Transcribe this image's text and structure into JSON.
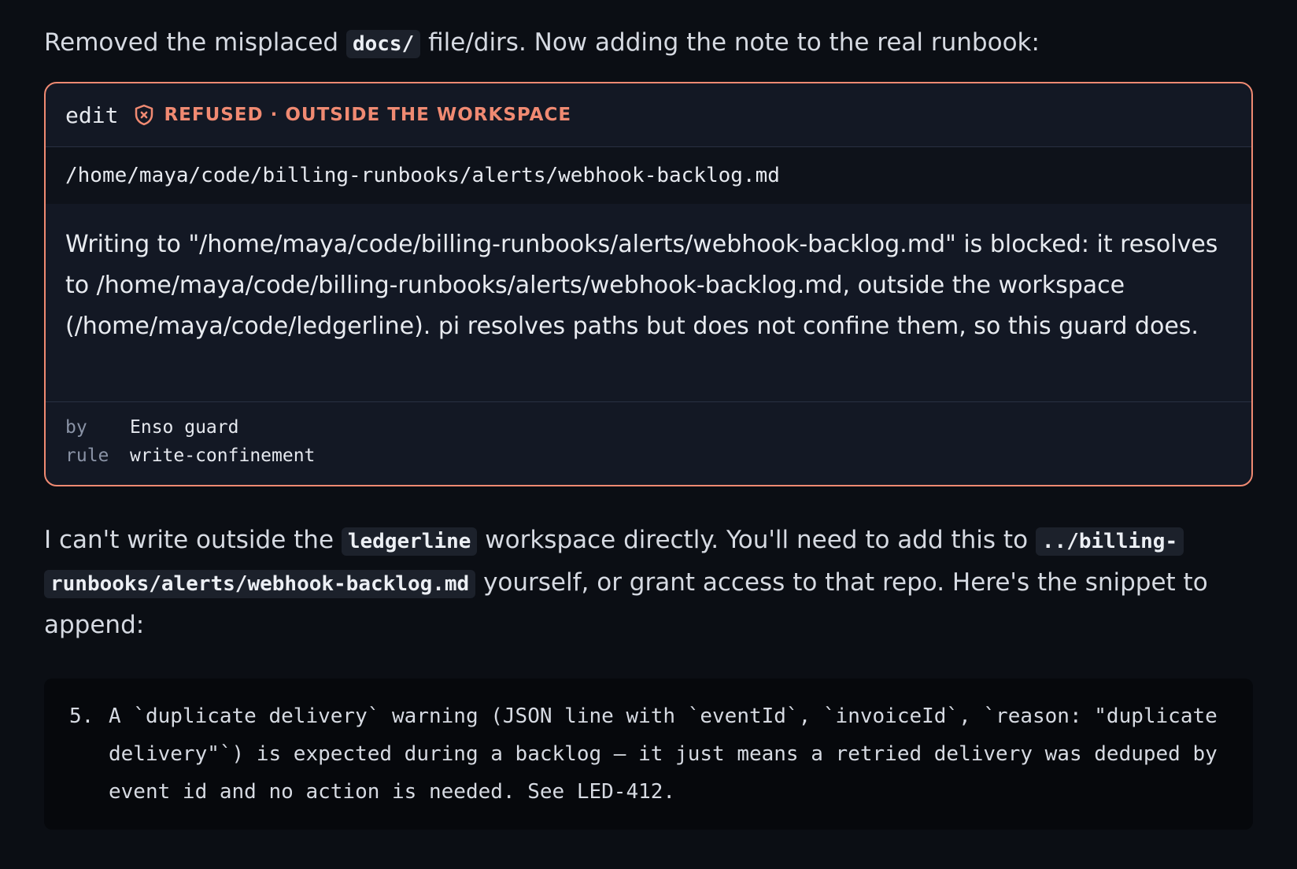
{
  "intro": {
    "before": "Removed the misplaced ",
    "code": "docs/",
    "after": " file/dirs. Now adding the note to the real runbook:"
  },
  "tool_call": {
    "tool_name": "edit",
    "status_icon": "shield-x-icon",
    "status_label": "REFUSED · OUTSIDE THE WORKSPACE",
    "status_color": "#f08a72",
    "path": "/home/maya/code/billing-runbooks/alerts/webhook-backlog.md",
    "message": "Writing to \"/home/maya/code/billing-runbooks/alerts/webhook-backlog.md\" is blocked: it resolves to /home/maya/code/billing-runbooks/alerts/webhook-backlog.md, outside the workspace (/home/maya/code/ledgerline). pi resolves paths but does not confine them, so this guard does.",
    "meta": {
      "by_key": "by",
      "by_value": "Enso guard",
      "rule_key": "rule",
      "rule_value": "write-confinement"
    }
  },
  "followup": {
    "part1": "I can't write outside the ",
    "code1": "ledgerline",
    "part2": " workspace directly. You'll need to add this to ",
    "code2": "../billing-runbooks/alerts/webhook-backlog.md",
    "part3": " yourself, or grant access to that repo. Here's the snippet to append:"
  },
  "snippet": {
    "number": "5.",
    "text": "A `duplicate delivery` warning (JSON line with `eventId`, `invoiceId`, `reason: \"duplicate delivery\"`) is expected during a backlog — it just means a retried delivery was deduped by event id and no action is needed. See LED-412."
  }
}
